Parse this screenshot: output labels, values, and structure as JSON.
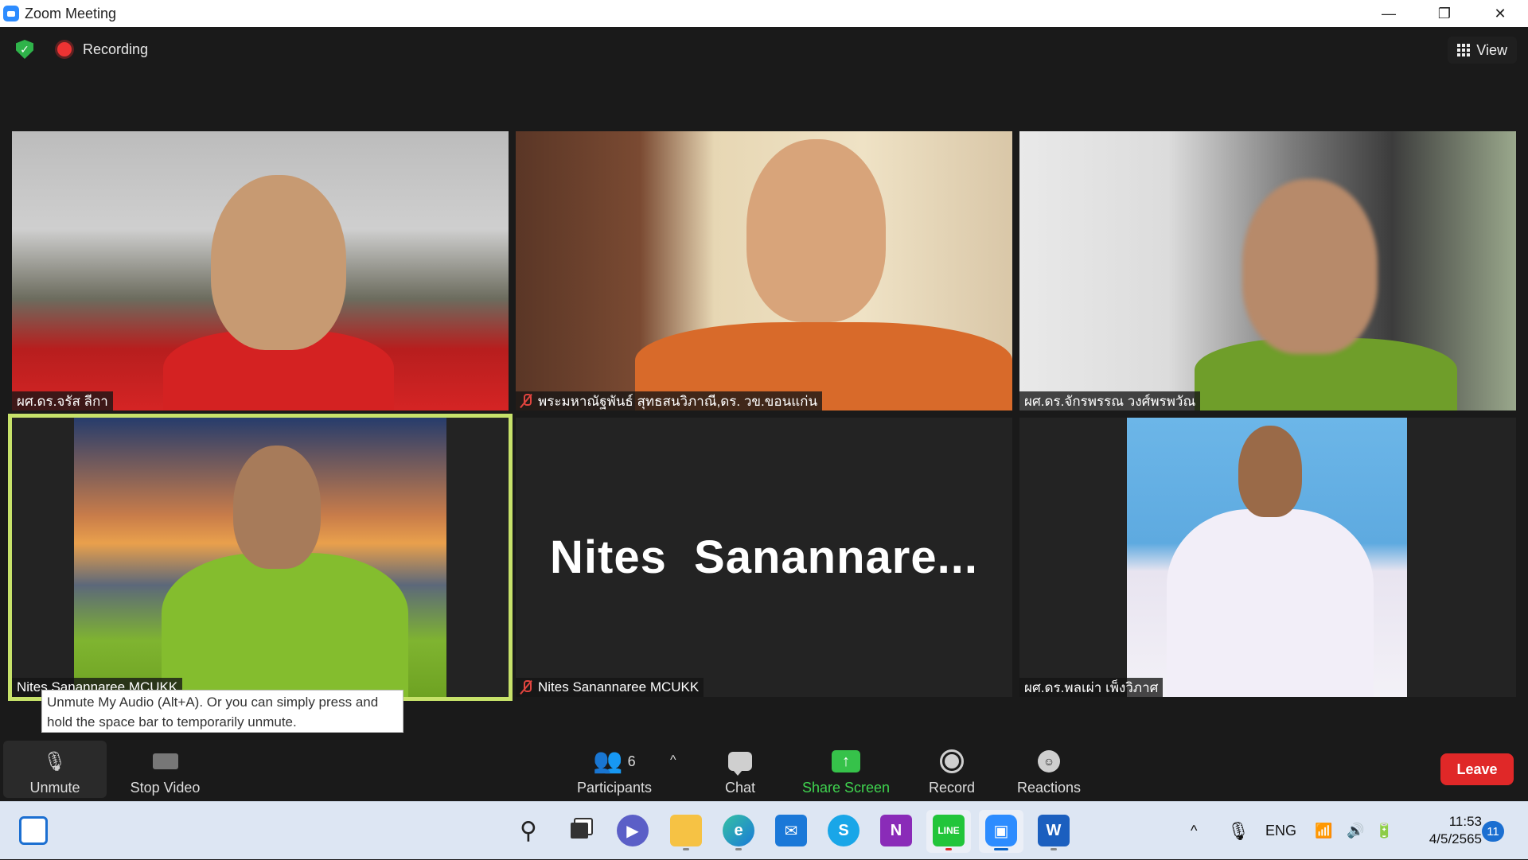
{
  "window": {
    "title": "Zoom Meeting",
    "controls": [
      "—",
      "❐",
      "✕"
    ]
  },
  "meeting": {
    "recording_label": "Recording",
    "view_label": "View",
    "tiles": [
      {
        "name": "ผศ.ดร.จรัส ลีกา",
        "muted": false
      },
      {
        "name": "พระมหาณัฐพันธ์ สุทธสนวิภาณี,ดร. วข.ขอนแก่น",
        "muted": true
      },
      {
        "name": "ผศ.ดร.จักรพรรณ วงศ์พรพวัณ",
        "muted": false
      },
      {
        "name": "Nites Sanannaree MCUKK",
        "muted": false,
        "active_speaker": true
      },
      {
        "name": "Nites Sanannaree MCUKK",
        "muted": true,
        "display_text": "Nites  Sanannare..."
      },
      {
        "name": "ผศ.ดร.พลเผ่า เพ็งวิภาศ",
        "muted": false
      }
    ]
  },
  "tooltip": {
    "line1": "Unmute My Audio (Alt+A). Or you can simply press and",
    "line2": "hold the space bar to temporarily unmute."
  },
  "toolbar": {
    "unmute": "Unmute",
    "stop_video": "Stop Video",
    "participants": "Participants",
    "participants_count": "6",
    "chat": "Chat",
    "share_screen": "Share Screen",
    "record": "Record",
    "reactions": "Reactions",
    "leave": "Leave",
    "share_color": "#3fd44f",
    "leave_color": "#e02828"
  },
  "taskbar": {
    "apps": [
      "widgets-icon",
      "windows-start-icon",
      "search-icon",
      "task-view-icon",
      "teams-chat-icon",
      "file-explorer-icon",
      "edge-icon",
      "mail-icon",
      "skype-icon",
      "onenote-icon",
      "line-icon",
      "zoom-icon",
      "word-icon"
    ],
    "onenote_letter": "N",
    "line_label": "LINE",
    "word_letter": "W",
    "language": "ENG",
    "time": "11:53",
    "date": "4/5/2565",
    "notification_count": "11"
  }
}
